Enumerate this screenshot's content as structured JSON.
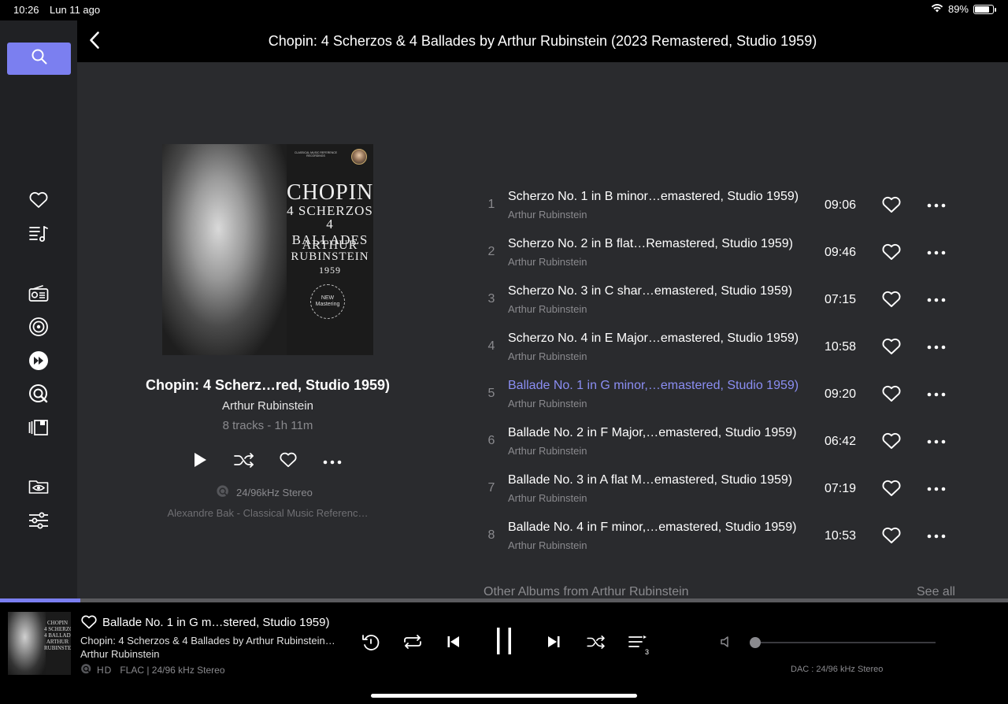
{
  "status_bar": {
    "time": "10:26",
    "date": "Lun 11 ago",
    "battery": "89%"
  },
  "header": {
    "title": "Chopin: 4 Scherzos & 4 Ballades by Arthur Rubinstein (2023 Remastered, Studio 1959)"
  },
  "sidebar": {
    "items": [
      {
        "icon": "search-icon",
        "active": true
      },
      {
        "icon": "heart-icon"
      },
      {
        "icon": "playlist-icon"
      },
      {
        "icon": "radio-icon"
      },
      {
        "icon": "target-icon"
      },
      {
        "icon": "fast-forward-icon"
      },
      {
        "icon": "qobuz-icon"
      },
      {
        "icon": "library-icon"
      },
      {
        "icon": "folder-eye-icon"
      },
      {
        "icon": "equalizer-icon"
      }
    ]
  },
  "album": {
    "cover_lines": [
      "CHOPIN",
      "4 SCHERZOS",
      "4 BALLADES",
      "ARTHUR",
      "RUBINSTEIN",
      "1959"
    ],
    "cover_small": "CLASSICAL MUSIC\nREFERENCE RECORDINGS",
    "cover_seal": "NEW\nMastering",
    "title": "Chopin: 4 Scherz…red, Studio 1959)",
    "artist": "Arthur Rubinstein",
    "meta": "8 tracks - 1h 11m",
    "quality": "24/96kHz Stereo",
    "label": "Alexandre Bak - Classical Music Referenc…"
  },
  "tracks": [
    {
      "num": "1",
      "title": "Scherzo No. 1 in B minor…emastered, Studio 1959)",
      "artist": "Arthur Rubinstein",
      "duration": "09:06"
    },
    {
      "num": "2",
      "title": "Scherzo No. 2 in B flat…Remastered, Studio 1959)",
      "artist": "Arthur Rubinstein",
      "duration": "09:46"
    },
    {
      "num": "3",
      "title": "Scherzo No. 3 in C shar…emastered, Studio 1959)",
      "artist": "Arthur Rubinstein",
      "duration": "07:15"
    },
    {
      "num": "4",
      "title": "Scherzo No. 4 in E Major…emastered, Studio 1959)",
      "artist": "Arthur Rubinstein",
      "duration": "10:58"
    },
    {
      "num": "5",
      "title": "Ballade No. 1 in G minor,…emastered, Studio 1959)",
      "artist": "Arthur Rubinstein",
      "duration": "09:20",
      "playing": true
    },
    {
      "num": "6",
      "title": "Ballade No. 2 in F Major,…emastered, Studio 1959)",
      "artist": "Arthur Rubinstein",
      "duration": "06:42"
    },
    {
      "num": "7",
      "title": "Ballade No. 3 in A flat M…emastered, Studio 1959)",
      "artist": "Arthur Rubinstein",
      "duration": "07:19"
    },
    {
      "num": "8",
      "title": "Ballade No. 4 in F minor,…emastered, Studio 1959)",
      "artist": "Arthur Rubinstein",
      "duration": "10:53"
    }
  ],
  "other_albums": {
    "label": "Other Albums from Arthur Rubinstein",
    "see_all": "See all"
  },
  "playback": {
    "progress_fraction": 0.08
  },
  "now_playing": {
    "art_text": "CHOPIN\n4 SCHERZOS\n4 BALLADES\nARTHUR\nRUBINSTEIN",
    "title": "Ballade No. 1 in G m…stered, Studio 1959)",
    "album": "Chopin: 4 Scherzos & 4 Ballades by Arthur Rubinstein…",
    "artist": "Arthur Rubinstein",
    "quality_hd": "HD",
    "quality_detail": "FLAC | 24/96 kHz Stereo",
    "queue_count": "3",
    "volume_fraction": 0.0,
    "dac": "DAC : 24/96 kHz Stereo"
  },
  "colors": {
    "accent": "#7b7ff0",
    "sidebar_bg": "#202124",
    "main_bg": "#2a2b2e",
    "muted_text": "#8a8a8e"
  }
}
